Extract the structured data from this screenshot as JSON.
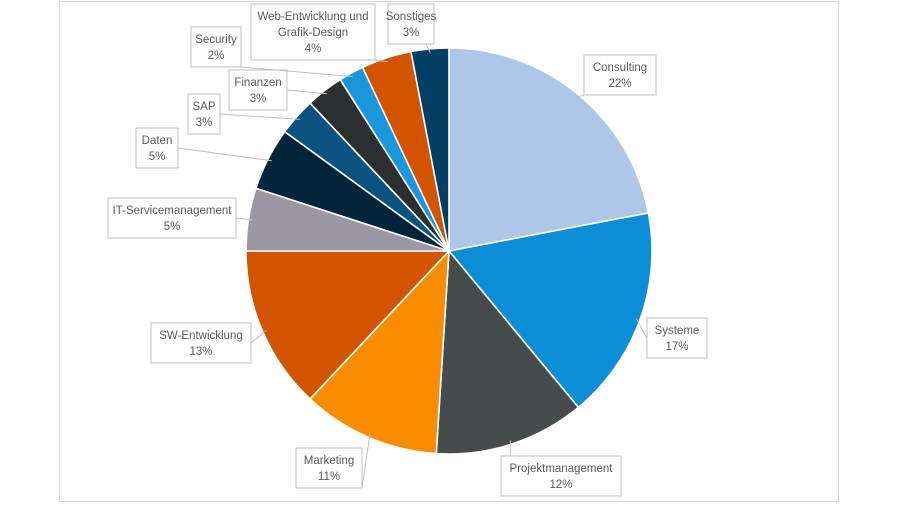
{
  "chart_data": {
    "type": "pie",
    "title": "",
    "start": "top",
    "direction": "clockwise",
    "unit": "%",
    "slices": [
      {
        "label": "Consulting",
        "value": 22,
        "display": "22%",
        "color": "#aec6e8"
      },
      {
        "label": "Systeme",
        "value": 17,
        "display": "17%",
        "color": "#0b8ed6"
      },
      {
        "label": "Projektmanagement",
        "value": 12,
        "display": "12%",
        "color": "#464b4b"
      },
      {
        "label": "Marketing",
        "value": 11,
        "display": "11%",
        "color": "#fa8c00"
      },
      {
        "label": "SW-Entwicklung",
        "value": 13,
        "display": "13%",
        "color": "#d35400"
      },
      {
        "label": "IT-Servicemanagement",
        "value": 5,
        "display": "5%",
        "color": "#9b98a3"
      },
      {
        "label": "Daten",
        "value": 5,
        "display": "5%",
        "color": "#02253a"
      },
      {
        "label": "SAP",
        "value": 3,
        "display": "3%",
        "color": "#0a5280"
      },
      {
        "label": "Finanzen",
        "value": 3,
        "display": "3%",
        "color": "#2b2f2f"
      },
      {
        "label": "Security",
        "value": 2,
        "display": "2%",
        "color": "#1a96dc"
      },
      {
        "label": "Web-Entwicklung und Grafik-Design",
        "label_lines": [
          "Web-Entwicklung und",
          "Grafik-Design"
        ],
        "value": 4,
        "display": "4%",
        "color": "#d35400"
      },
      {
        "label": "Sonstiges",
        "value": 3,
        "display": "3%",
        "color": "#033f63"
      }
    ],
    "data_labels": "callout boxes with category name and percentage",
    "legend": "none"
  }
}
